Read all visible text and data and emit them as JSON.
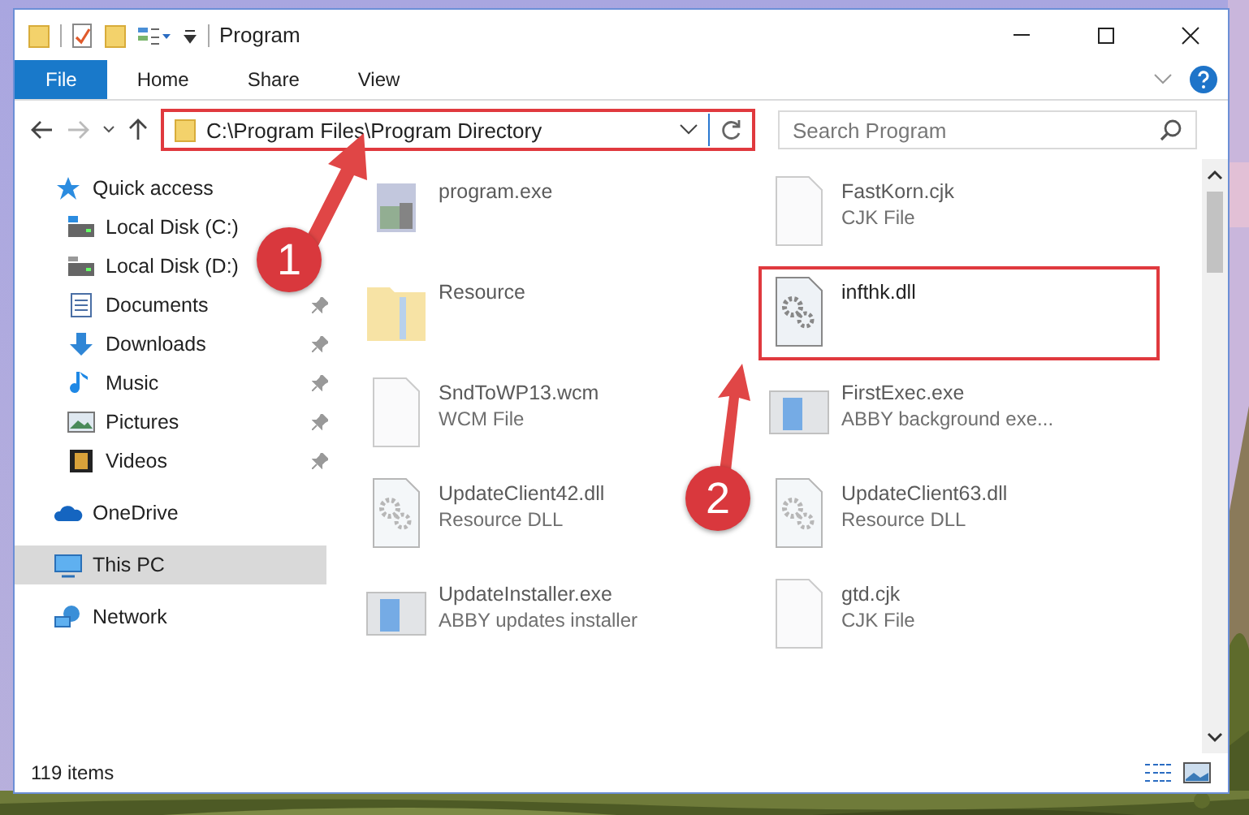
{
  "window": {
    "title": "Program"
  },
  "ribbon": {
    "tabs": [
      {
        "label": "File",
        "selected": true
      },
      {
        "label": "Home",
        "selected": false
      },
      {
        "label": "Share",
        "selected": false
      },
      {
        "label": "View",
        "selected": false
      }
    ]
  },
  "address": {
    "path": "C:\\Program Files\\Program Directory",
    "highlighted": true
  },
  "search": {
    "placeholder": "Search Program"
  },
  "sidebar": {
    "items": [
      {
        "label": "Quick access",
        "kind": "star",
        "selected": false,
        "children": [
          {
            "label": "Local Disk (C:)",
            "kind": "drive-c",
            "pinned": false,
            "selected": false
          },
          {
            "label": "Local Disk (D:)",
            "kind": "drive",
            "pinned": false,
            "selected": false
          },
          {
            "label": "Documents",
            "kind": "documents",
            "pinned": true,
            "selected": false
          },
          {
            "label": "Downloads",
            "kind": "downloads",
            "pinned": true,
            "selected": false
          },
          {
            "label": "Music",
            "kind": "music",
            "pinned": true,
            "selected": false
          },
          {
            "label": "Pictures",
            "kind": "pictures",
            "pinned": true,
            "selected": false
          },
          {
            "label": "Videos",
            "kind": "videos",
            "pinned": true,
            "selected": false
          }
        ]
      },
      {
        "label": "OneDrive",
        "kind": "cloud",
        "selected": false
      },
      {
        "label": "This PC",
        "kind": "pc",
        "selected": true
      },
      {
        "label": "Network",
        "kind": "network",
        "selected": false
      }
    ]
  },
  "files": [
    {
      "name": "program.exe",
      "kind": "setup",
      "blurred": true,
      "highlighted": false
    },
    {
      "name": "FastKorn.cjk",
      "type": "CJK File",
      "kind": "blank",
      "blurred": true,
      "highlighted": false
    },
    {
      "name": "Resource",
      "kind": "folder",
      "blurred": true,
      "highlighted": false
    },
    {
      "name": "infthk.dll",
      "kind": "dll",
      "blurred": false,
      "highlighted": true
    },
    {
      "name": "SndToWP13.wcm",
      "type": "WCM File",
      "kind": "blank",
      "blurred": true,
      "highlighted": false
    },
    {
      "name": "FirstExec.exe",
      "type": "ABBY background exe...",
      "kind": "app",
      "blurred": true,
      "highlighted": false
    },
    {
      "name": "UpdateClient42.dll",
      "type": "Resource DLL",
      "kind": "dll",
      "blurred": true,
      "highlighted": false
    },
    {
      "name": "UpdateClient63.dll",
      "type": "Resource DLL",
      "kind": "dll",
      "blurred": true,
      "highlighted": false
    },
    {
      "name": "UpdateInstaller.exe",
      "type": "ABBY updates installer",
      "kind": "app",
      "blurred": true,
      "highlighted": false
    },
    {
      "name": "gtd.cjk",
      "type": "CJK File",
      "kind": "blank",
      "blurred": true,
      "highlighted": false
    }
  ],
  "status_bar": {
    "count": "119 items"
  },
  "annotations": [
    {
      "label": "1"
    },
    {
      "label": "2"
    }
  ]
}
